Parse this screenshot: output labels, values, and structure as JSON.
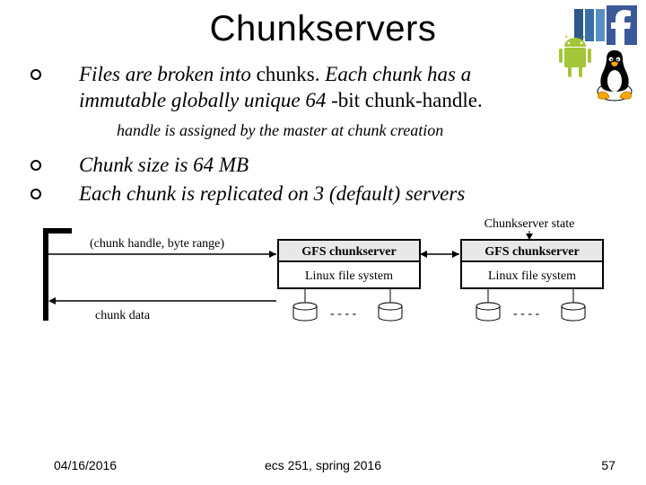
{
  "title": "Chunkservers",
  "bullets": {
    "b1_pre": "Files are broken into ",
    "b1_u1": "chunks. ",
    "b1_mid": "Each chunk has a immutable globally unique 64",
    "b1_u2": " -bit ",
    "b1_u3": "chunk-handle.",
    "sub": "handle is assigned by the master at chunk creation",
    "b2": "Chunk size is 64 MB",
    "b3": "Each chunk is replicated on 3 (default) servers"
  },
  "diagram": {
    "left_top": "(chunk handle, byte range)",
    "left_bottom": "chunk data",
    "server_title": "GFS chunkserver",
    "server_sub": "Linux file system",
    "state_label": "Chunkserver state"
  },
  "footer": {
    "date": "04/16/2016",
    "course": "ecs 251, spring 2016",
    "page": "57"
  },
  "icons": {
    "android": "android-icon",
    "facebook": "facebook-icon",
    "bluestack": "stack-icon",
    "tux": "tux-icon"
  }
}
